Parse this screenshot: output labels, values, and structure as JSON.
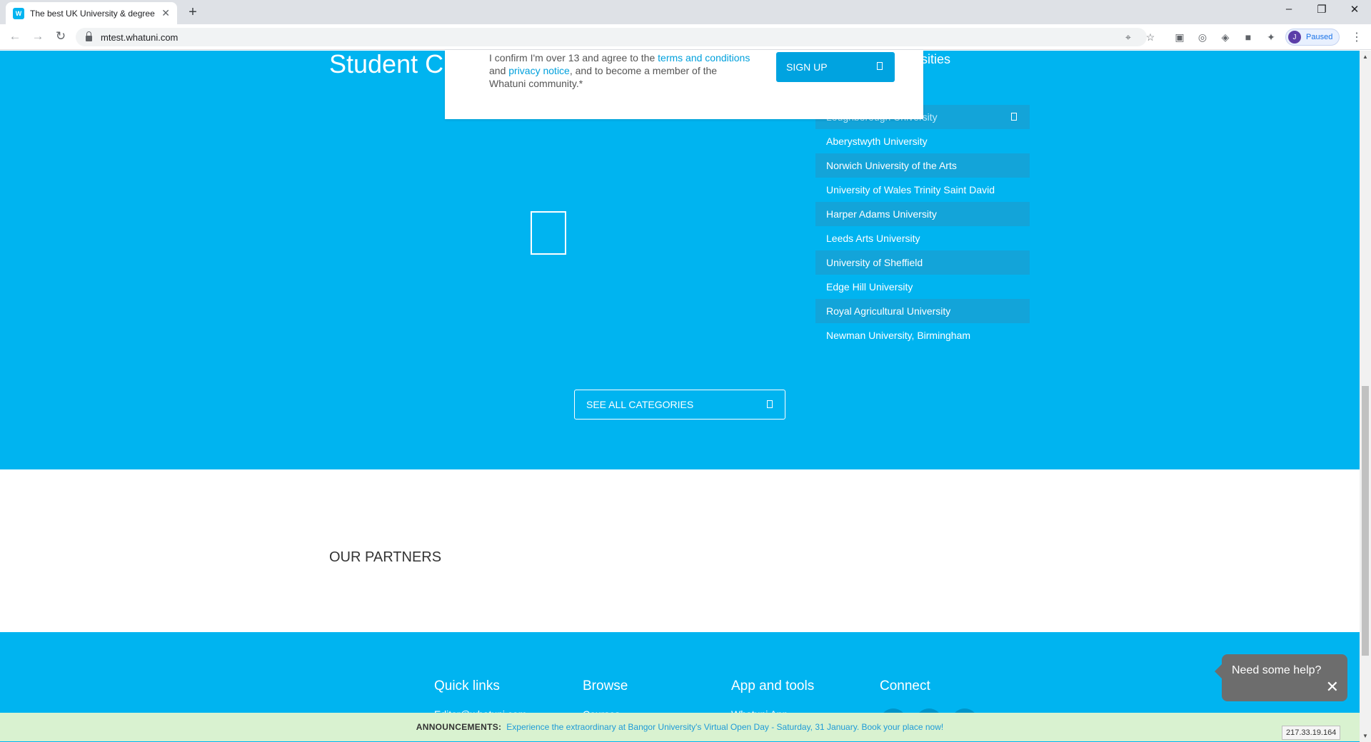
{
  "browser": {
    "tab_title": "The best UK University & degree",
    "tab_favicon": "W",
    "url": "mtest.whatuni.com",
    "profile_initial": "J",
    "profile_label": "Paused"
  },
  "page": {
    "section_heading": "Student C",
    "heading_fragment": "sities",
    "universities": [
      "Loughborough University",
      "Aberystwyth University",
      "Norwich University of the Arts",
      "University of Wales Trinity Saint David",
      "Harper Adams University",
      "Leeds Arts University",
      "University of Sheffield",
      "Edge Hill University",
      "Royal Agricultural University",
      "Newman University, Birmingham"
    ],
    "see_all_label": "SEE ALL CATEGORIES",
    "partners_heading": "OUR PARTNERS"
  },
  "modal": {
    "text_1": "I confirm I'm over 13 and agree to the ",
    "terms_link": "terms and conditions",
    "text_2": "and ",
    "privacy_link": "privacy notice",
    "text_3": ", and to become a member of the Whatuni community.*",
    "signup_label": "SIGN UP"
  },
  "footer": {
    "columns": [
      {
        "heading": "Quick links",
        "first_link": "Editor@whatuni.com"
      },
      {
        "heading": "Browse",
        "first_link": "Courses"
      },
      {
        "heading": "App and tools",
        "first_link": "Whatuni App"
      },
      {
        "heading": "Connect",
        "first_link": ""
      }
    ]
  },
  "help_chat": {
    "label": "Need some help?",
    "close": "✕"
  },
  "announcement": {
    "label": "ANNOUNCEMENTS:",
    "text": "Experience the extraordinary at Bangor University's Virtual Open Day - Saturday, 31 January. Book your place now!"
  },
  "ip_address": "217.33.19.164",
  "colors": {
    "brand": "#00b4f0",
    "announcement_bg": "#d9f2d0",
    "help_bg": "#6d6d6d"
  }
}
